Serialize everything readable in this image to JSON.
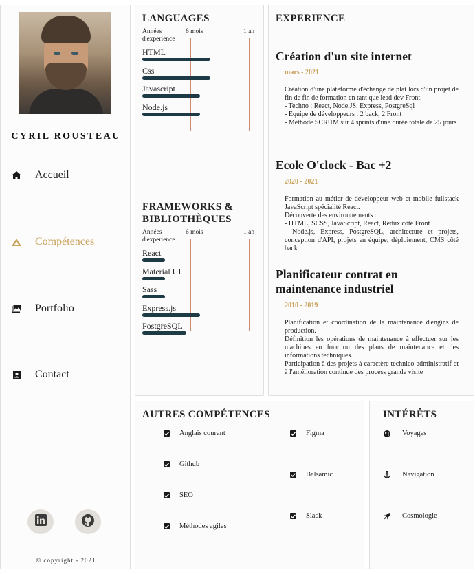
{
  "profile": {
    "name": "CYRIL ROUSTEAU"
  },
  "nav": {
    "items": [
      {
        "label": "Accueil",
        "icon": "home-icon"
      },
      {
        "label": "Compétences",
        "icon": "triangle-icon"
      },
      {
        "label": "Portfolio",
        "icon": "images-icon"
      },
      {
        "label": "Contact",
        "icon": "contact-card-icon"
      }
    ],
    "active": "Compétences"
  },
  "social": [
    {
      "icon": "linkedin-icon"
    },
    {
      "icon": "github-icon"
    }
  ],
  "footer": {
    "copyright": "© copyright - 2021"
  },
  "languages": {
    "title": "LANGUAGES",
    "scale": {
      "start": "Années d'experience",
      "mid": "6 mois",
      "end": "1 an"
    },
    "skills": [
      {
        "name": "HTML",
        "level": 1.0
      },
      {
        "name": "Css",
        "level": 1.0
      },
      {
        "name": "Javascript",
        "level": 0.85
      },
      {
        "name": "Node.js",
        "level": 0.85
      }
    ]
  },
  "frameworks": {
    "title": "FRAMEWORKS & BIBLIOTHÈQUES",
    "scale": {
      "start": "Années d'experience",
      "mid": "6 mois",
      "end": "1 an"
    },
    "skills": [
      {
        "name": "React",
        "level": 0.33
      },
      {
        "name": "Material UI",
        "level": 0.33
      },
      {
        "name": "Sass",
        "level": 0.33
      },
      {
        "name": "Express.js",
        "level": 0.85
      },
      {
        "name": "PostgreSQL",
        "level": 0.65
      }
    ]
  },
  "experience": {
    "title": "EXPERIENCE",
    "items": [
      {
        "title": "Création d'un site internet",
        "date": "mars - 2021",
        "description": "Création d'une plateforme d'échange de plat lors d'un projet de fin de fin de formation en tant que lead dev Front.\n- Techno : React, Node.JS, Express, PostgreSql\n- Equipe de développeurs : 2 back, 2 Front\n- Méthode SCRUM sur 4 sprints d'une durée totale de 25 jours"
      },
      {
        "title": "Ecole O'clock - Bac +2",
        "date": "2020 - 2021",
        "description": "Formation au métier de développeur web et mobile fullstack JavaScript spécialité React.\nDécouverte des environnements :\n- HTML, SCSS, JavaScript, React, Redux côté Front\n- Node.js, Express, PostgreSQL, architecture et projets, conception d'API, projets en équipe, déploiement, CMS côté back"
      },
      {
        "title": "Planificateur contrat en maintenance industriel",
        "date": "2010 - 2019",
        "description": "Planification et coordination de la maintenance d'engins de production.\nDéfinition les opérations de maintenance à effectuer sur les machines en fonction des plans de maintenance et des informations techniques.\nParticipation à des projets à caractère technico-administratif et à l'amélioration continue des process grande visite"
      }
    ]
  },
  "other_skills": {
    "title": "AUTRES COMPÉTENCES",
    "left": [
      "Anglais courant",
      "Github",
      "SEO",
      "Méthodes agiles"
    ],
    "right": [
      "Figma",
      "Balsamic",
      "Slack"
    ]
  },
  "interests": {
    "title": "INTÉRÊTS",
    "items": [
      {
        "label": "Voyages",
        "icon": "globe-icon"
      },
      {
        "label": "Navigation",
        "icon": "anchor-icon"
      },
      {
        "label": "Cosmologie",
        "icon": "rocket-icon"
      }
    ]
  },
  "colors": {
    "accent": "#c9a15a",
    "bar": "#1e3a44",
    "scale_line": "#d08a72"
  }
}
